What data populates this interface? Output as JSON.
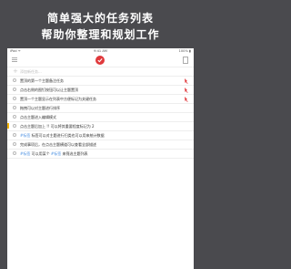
{
  "promo": {
    "line1": "简单强大的任务列表",
    "line2": "帮助你整理和规划工作"
  },
  "status_bar": {
    "left": "iPad ᯤ",
    "time": "9:41 AM",
    "right": "100% ▮"
  },
  "nav": {
    "logo_icon": "check-circle-icon",
    "accent_color": "#e0393c"
  },
  "add_row": {
    "placeholder": "添加新任务..."
  },
  "tasks": [
    {
      "text": "置顶的第一个主题备注任务",
      "pinned": true
    },
    {
      "text": "点击右侧的图钉按钮可以让主题置顶",
      "pinned": true
    },
    {
      "text": "置顶一个主题显示在列表中方便标记为关键任务",
      "pinned": true
    },
    {
      "text": "拖拽可以对主题进行排序",
      "pinned": false
    },
    {
      "text": "点击主题进入编辑模式",
      "pinned": false
    },
    {
      "text": "点击主题后加上 !! 可以将其重要程度标记为 2",
      "pinned": false
    },
    {
      "prefix": "#标签",
      "text": " 标签可以对主题进行归类也可以用来统计数据",
      "pinned": false
    },
    {
      "text": "完成事项后，在点击主题横道可以查看全部描述",
      "pinned": false
    },
    {
      "prefix": "#标签",
      "text": " 可以用某个 ",
      "suffix_tag": "#标签",
      "tail": " 来筛选主题列表",
      "pinned": false
    }
  ]
}
